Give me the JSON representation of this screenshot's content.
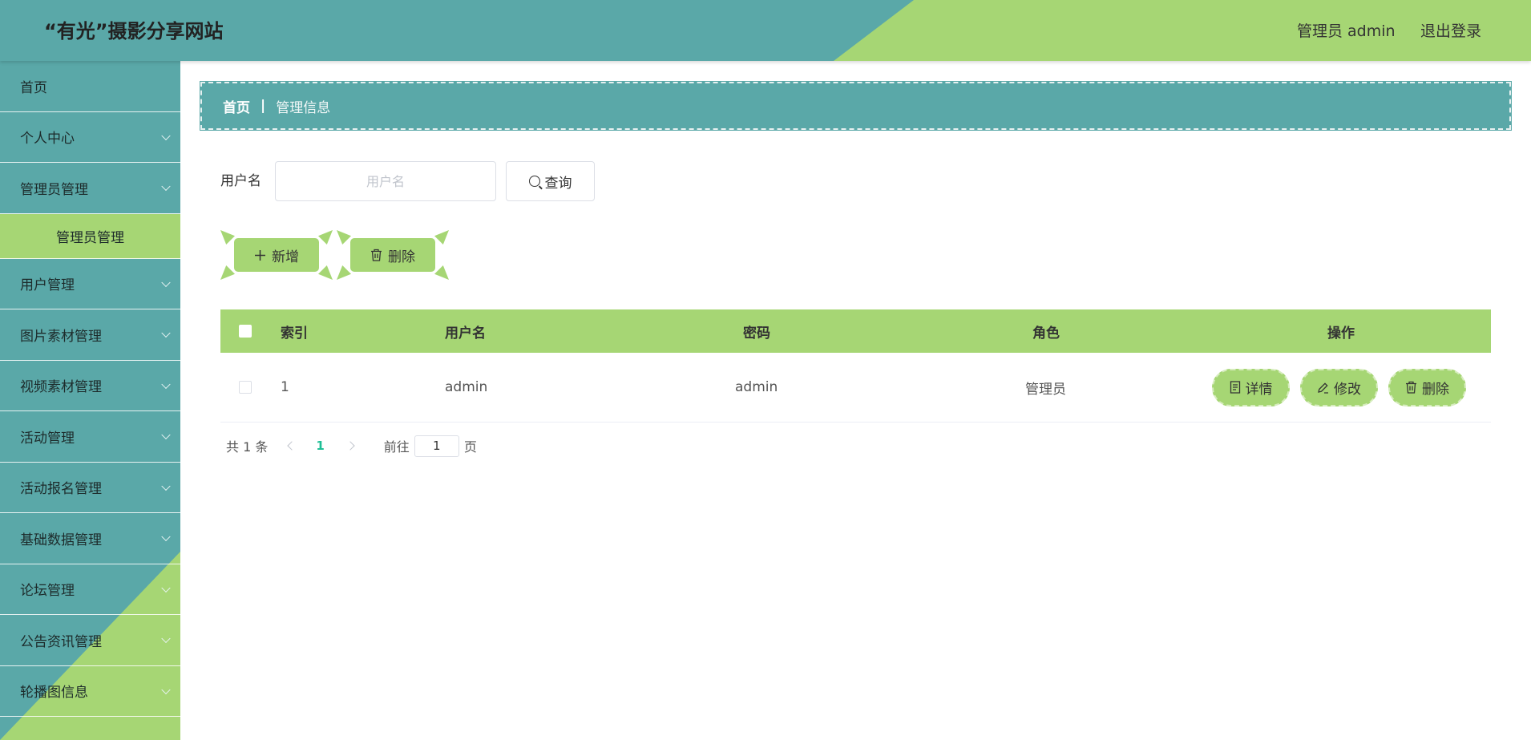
{
  "header": {
    "title": "“有光”摄影分享网站",
    "admin_label": "管理员 admin",
    "logout_label": "退出登录"
  },
  "sidebar": {
    "items": [
      {
        "label": "首页",
        "chevron": false
      },
      {
        "label": "个人中心",
        "chevron": true
      },
      {
        "label": "管理员管理",
        "chevron": true
      },
      {
        "label": "用户管理",
        "chevron": true
      },
      {
        "label": "图片素材管理",
        "chevron": true
      },
      {
        "label": "视频素材管理",
        "chevron": true
      },
      {
        "label": "活动管理",
        "chevron": true
      },
      {
        "label": "活动报名管理",
        "chevron": true
      },
      {
        "label": "基础数据管理",
        "chevron": true
      },
      {
        "label": "论坛管理",
        "chevron": true
      },
      {
        "label": "公告资讯管理",
        "chevron": true
      },
      {
        "label": "轮播图信息",
        "chevron": true
      }
    ],
    "active_sub": "管理员管理"
  },
  "breadcrumb": {
    "home": "首页",
    "separator": "|",
    "current": "管理信息"
  },
  "search": {
    "label": "用户名",
    "value": "",
    "placeholder": "用户名",
    "button_label": "查询"
  },
  "actions": {
    "add_label": "新增",
    "delete_label": "删除"
  },
  "table": {
    "columns": [
      "索引",
      "用户名",
      "密码",
      "角色",
      "操作"
    ],
    "rows": [
      {
        "index": "1",
        "username": "admin",
        "password": "admin",
        "role": "管理员"
      }
    ],
    "row_ops": {
      "detail_label": "详情",
      "edit_label": "修改",
      "delete_label": "删除"
    }
  },
  "pagination": {
    "total_text": "共 1 条",
    "current_page": "1",
    "goto_label": "前往",
    "goto_value": "1",
    "page_suffix": "页"
  },
  "colors": {
    "teal": "#5aa8a8",
    "green": "#a6d674",
    "active_page": "#1fbf96"
  }
}
